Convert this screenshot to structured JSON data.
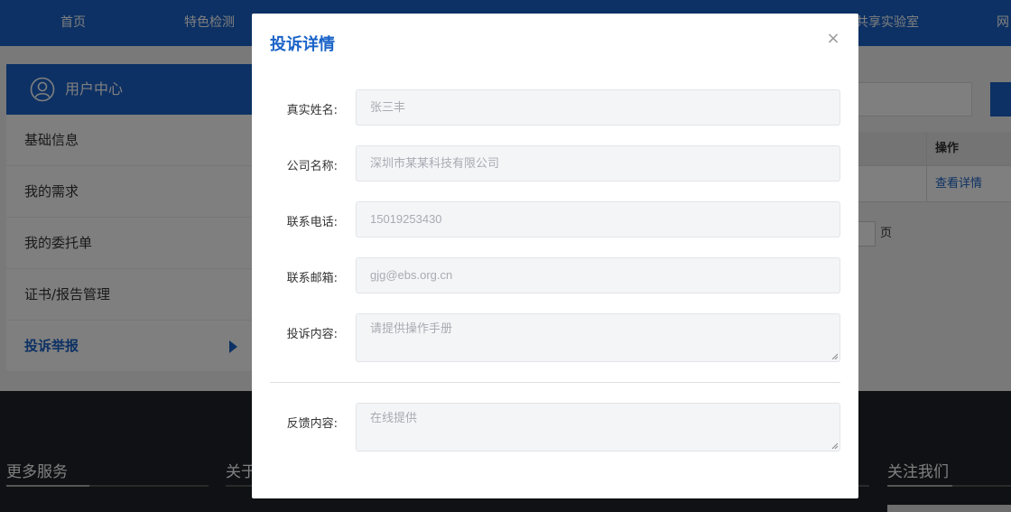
{
  "nav": [
    "首页",
    "特色检测",
    "共享实验室",
    "网"
  ],
  "sidebar": {
    "title": "用户中心",
    "items": [
      {
        "label": "基础信息"
      },
      {
        "label": "我的需求"
      },
      {
        "label": "我的委托单"
      },
      {
        "label": "证书/报告管理"
      },
      {
        "label": "投诉举报"
      }
    ]
  },
  "table": {
    "op_header": "操作",
    "detail_link": "查看详情"
  },
  "pagination": {
    "suffix": "页"
  },
  "footer": {
    "col1": "更多服务",
    "col2": "关于",
    "col3": "关注我们"
  },
  "modal": {
    "title": "投诉详情",
    "close_icon": "×",
    "fields": [
      {
        "label": "真实姓名:",
        "value": "张三丰"
      },
      {
        "label": "公司名称:",
        "value": "深圳市某某科技有限公司"
      },
      {
        "label": "联系电话:",
        "value": "15019253430"
      },
      {
        "label": "联系邮箱:",
        "value": "gjg@ebs.org.cn"
      },
      {
        "label": "投诉内容:",
        "value": "请提供操作手册"
      },
      {
        "label": "反馈内容:",
        "value": "在线提供"
      }
    ]
  },
  "colors": {
    "brand": "#1a63c8",
    "footer_bg": "#1f2329"
  }
}
